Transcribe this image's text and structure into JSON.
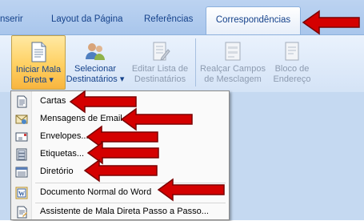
{
  "tabs": [
    "nserir",
    "Layout da Página",
    "Referências",
    "Correspondências"
  ],
  "ribbon": {
    "start_mail_merge": [
      "Iniciar Mala",
      "Direta ▾"
    ],
    "select_recipients": [
      "Selecionar",
      "Destinatários ▾"
    ],
    "edit_list": [
      "Editar Lista de",
      "Destinatários"
    ],
    "highlight_fields": [
      "Realçar Campos",
      "de Mesclagem"
    ],
    "address_block": [
      "Bloco de",
      "Endereço"
    ]
  },
  "menu": {
    "items": [
      {
        "label": "Cartas",
        "icon": "letter-icon"
      },
      {
        "label": "Mensagens de Email",
        "icon": "email-icon"
      },
      {
        "label": "Envelopes...",
        "icon": "envelope-icon"
      },
      {
        "label": "Etiquetas...",
        "icon": "labels-icon"
      },
      {
        "label": "Diretório",
        "icon": "directory-icon"
      },
      {
        "label": "Documento Normal do Word",
        "icon": "word-document-icon"
      },
      {
        "label": "Assistente de Mala Direta Passo a Passo...",
        "icon": "wizard-icon"
      }
    ]
  },
  "colors": {
    "arrow": "#d40000",
    "accent": "#15428b",
    "highlight": "#ffd062"
  }
}
